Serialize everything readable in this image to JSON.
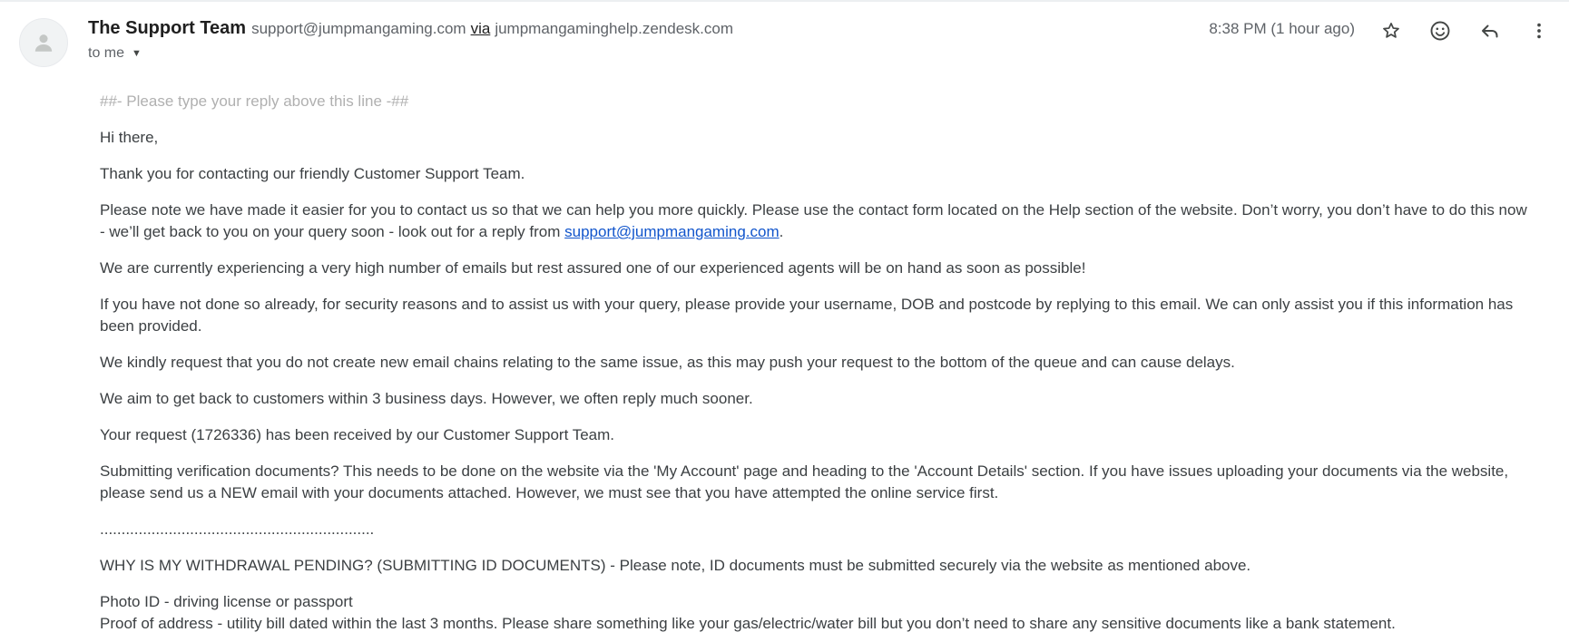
{
  "header": {
    "sender_name": "The Support Team",
    "sender_email": "support@jumpmangaming.com",
    "via_word": "via",
    "via_domain": "jumpmangaminghelp.zendesk.com",
    "to_label": "to me",
    "timestamp": "8:38 PM (1 hour ago)"
  },
  "icons": {
    "avatar": "person-icon",
    "star": "star-icon",
    "emoji": "emoji-icon",
    "reply": "reply-icon",
    "more": "more-vert-icon",
    "caret": "caret-down-icon"
  },
  "body": {
    "reply_line": "##- Please type your reply above this line -##",
    "greeting": "Hi there,",
    "thanks": "Thank you for contacting our friendly Customer Support Team.",
    "contact_note_pre": "Please note we have made it easier for you to contact us so that we can help you more quickly. Please use the contact form located on the Help section of the website. Don’t worry, you don’t have to do this now - we’ll get back to you on your query soon - look out for a reply from ",
    "contact_link": "support@jumpmangaming.com",
    "contact_note_post": ".",
    "volume_note": "We are currently experiencing a very high number of emails but rest assured one of our experienced agents will be on hand as soon as possible!",
    "security_note": "If you have not done so already, for security reasons and to assist us with your query, please provide your username, DOB and postcode by replying to this email. We can only assist you if this information has been provided.",
    "chains_note": "We kindly request that you do not create new email chains relating to the same issue, as this may push your request to the bottom of the queue and can cause delays.",
    "aim_note": "We aim to get back to customers within 3 business days. However, we often reply much sooner.",
    "request_note": "Your request (1726336) has been received by our Customer Support Team.",
    "verification_note": "Submitting verification documents? This needs to be done on the website via the 'My Account' page and heading to the 'Account Details' section. If you have issues uploading your documents via the website, please send us a NEW email with your documents attached. However, we must see that you have attempted the online service first.",
    "dots": "................................................................",
    "withdrawal_heading": "WHY IS MY WITHDRAWAL PENDING? (SUBMITTING ID DOCUMENTS) - Please note, ID documents must be submitted securely via the website as mentioned above.",
    "photo_id": "Photo ID - driving license or passport",
    "proof_of_address": "Proof of address - utility bill dated within the last 3 months. Please share something like your gas/electric/water bill but you don’t need to share any sensitive documents like a bank statement."
  }
}
